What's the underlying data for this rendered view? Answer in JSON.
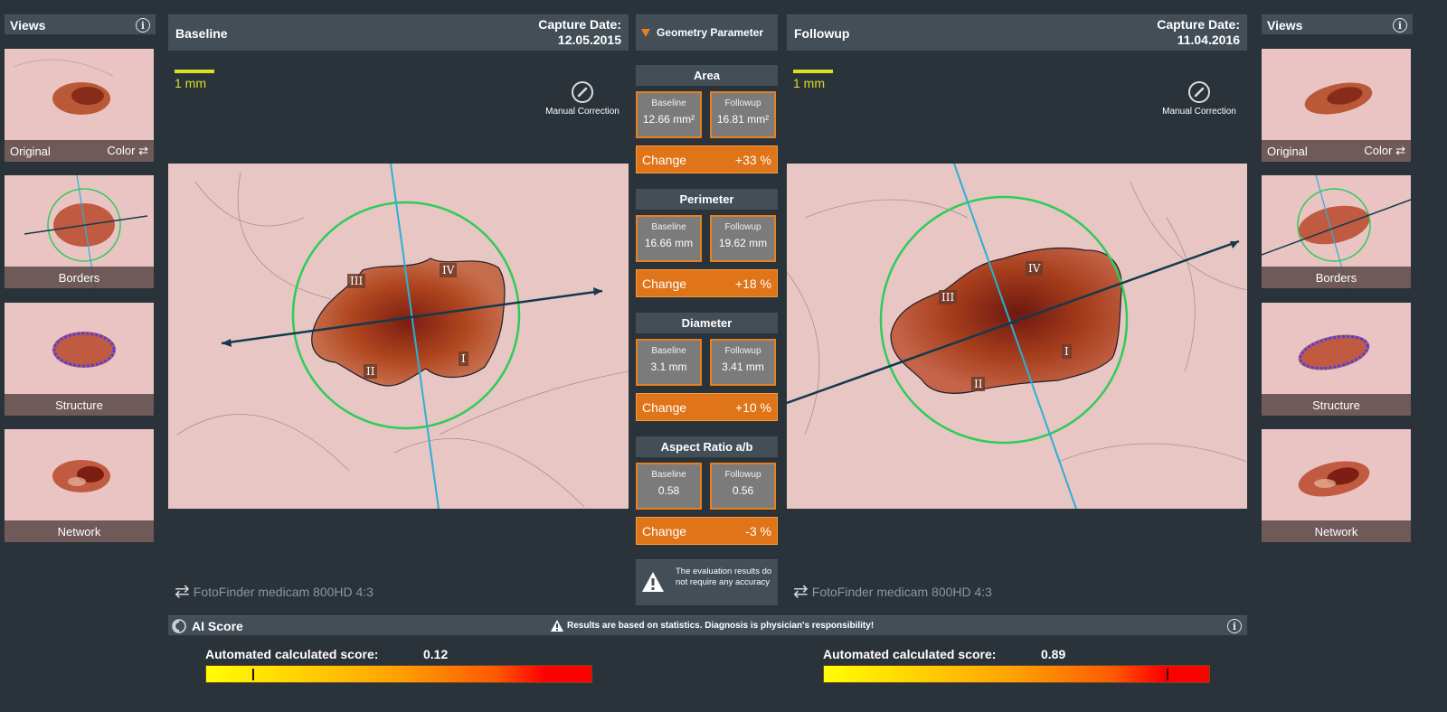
{
  "left_views": {
    "title": "Views",
    "items": [
      {
        "label": "Original",
        "extra": "Color"
      },
      {
        "label": "Borders"
      },
      {
        "label": "Structure"
      },
      {
        "label": "Network"
      }
    ]
  },
  "right_views": {
    "title": "Views",
    "items": [
      {
        "label": "Original",
        "extra": "Color"
      },
      {
        "label": "Borders"
      },
      {
        "label": "Structure"
      },
      {
        "label": "Network"
      }
    ]
  },
  "baseline": {
    "title": "Baseline",
    "capture_label": "Capture Date:",
    "capture_date": "12.05.2015",
    "scale": "1 mm",
    "manual_correction": "Manual Correction",
    "camera": "FotoFinder medicam 800HD 4:3",
    "regions": [
      "I",
      "II",
      "III",
      "IV"
    ]
  },
  "followup": {
    "title": "Followup",
    "capture_label": "Capture Date:",
    "capture_date": "11.04.2016",
    "scale": "1 mm",
    "manual_correction": "Manual Correction",
    "camera": "FotoFinder medicam 800HD 4:3",
    "regions": [
      "I",
      "II",
      "III",
      "IV"
    ]
  },
  "geometry": {
    "title": "Geometry Parameter",
    "baseline_label": "Baseline",
    "followup_label": "Followup",
    "change_label": "Change",
    "params": [
      {
        "name": "Area",
        "baseline": "12.66 mm²",
        "followup": "16.81 mm²",
        "change": "+33 %"
      },
      {
        "name": "Perimeter",
        "baseline": "16.66 mm",
        "followup": "19.62 mm",
        "change": "+18 %"
      },
      {
        "name": "Diameter",
        "baseline": "3.1 mm",
        "followup": "3.41 mm",
        "change": "+10 %"
      },
      {
        "name": "Aspect Ratio a/b",
        "baseline": "0.58",
        "followup": "0.56",
        "change": "-3 %"
      }
    ],
    "warning": "The evaluation results do not require any accuracy"
  },
  "ai_score": {
    "title": "AI Score",
    "disclaimer": "Results are based on statistics. Diagnosis is physician's responsibility!",
    "score_label": "Automated calculated score:",
    "baseline_score": "0.12",
    "baseline_score_value": 0.12,
    "followup_score": "0.89",
    "followup_score_value": 0.89
  },
  "colors": {
    "accent_orange": "#df7418",
    "scale_yellow": "#d9e026",
    "circle_green": "#2ecc5a",
    "axis_cyan": "#2ab0d8",
    "axis_dark": "#123a4e"
  }
}
